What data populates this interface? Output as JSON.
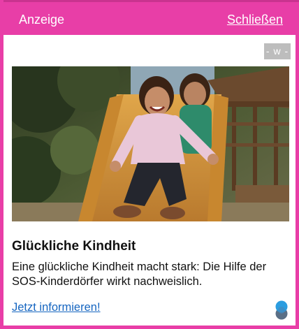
{
  "header": {
    "ad_label": "Anzeige",
    "close_label": "Schließen"
  },
  "badge": {
    "text": "- w -"
  },
  "ad": {
    "image_alt": "Zwei lachende Kinder auf einer Rutsche",
    "title": "Glückliche Kindheit",
    "description": "Eine glückliche Kindheit macht stark: Die Hilfe der SOS-Kinderdörfer wirkt nachweislich.",
    "cta_label": "Jetzt informieren!"
  },
  "colors": {
    "frame": "#e83ea7",
    "link": "#1565c0",
    "badge": "#bdbdbd",
    "info_icon_top": "#2b9de0",
    "info_icon_bottom": "#5a6f86"
  },
  "icons": {
    "info": "adchoices-info-icon"
  }
}
